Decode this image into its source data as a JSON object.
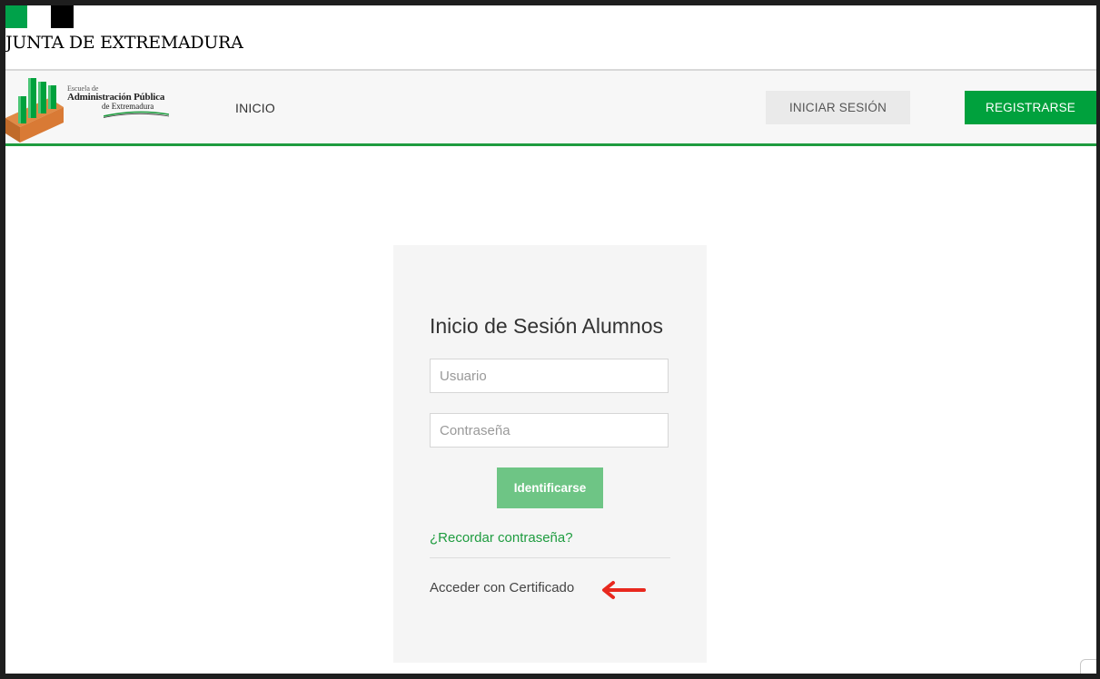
{
  "header": {
    "org_title": "JUNTA DE EXTREMADURA"
  },
  "logo": {
    "line1": "Escuela de",
    "line2": "Administración Pública",
    "line3": "de Extremadura"
  },
  "nav": {
    "home_label": "INICIO",
    "login_label": "INICIAR SESIÓN",
    "register_label": "REGISTRARSE"
  },
  "login_form": {
    "title": "Inicio de Sesión Alumnos",
    "username_placeholder": "Usuario",
    "password_placeholder": "Contraseña",
    "submit_label": "Identificarse",
    "forgot_password_label": "¿Recordar contraseña?",
    "certificate_label": "Acceder con Certificado"
  },
  "colors": {
    "brand_green": "#00a13d",
    "accent_green": "#1e9c3f",
    "annotation_arrow": "#e8281e"
  },
  "icons": {
    "arrow": "arrow-left-icon"
  }
}
